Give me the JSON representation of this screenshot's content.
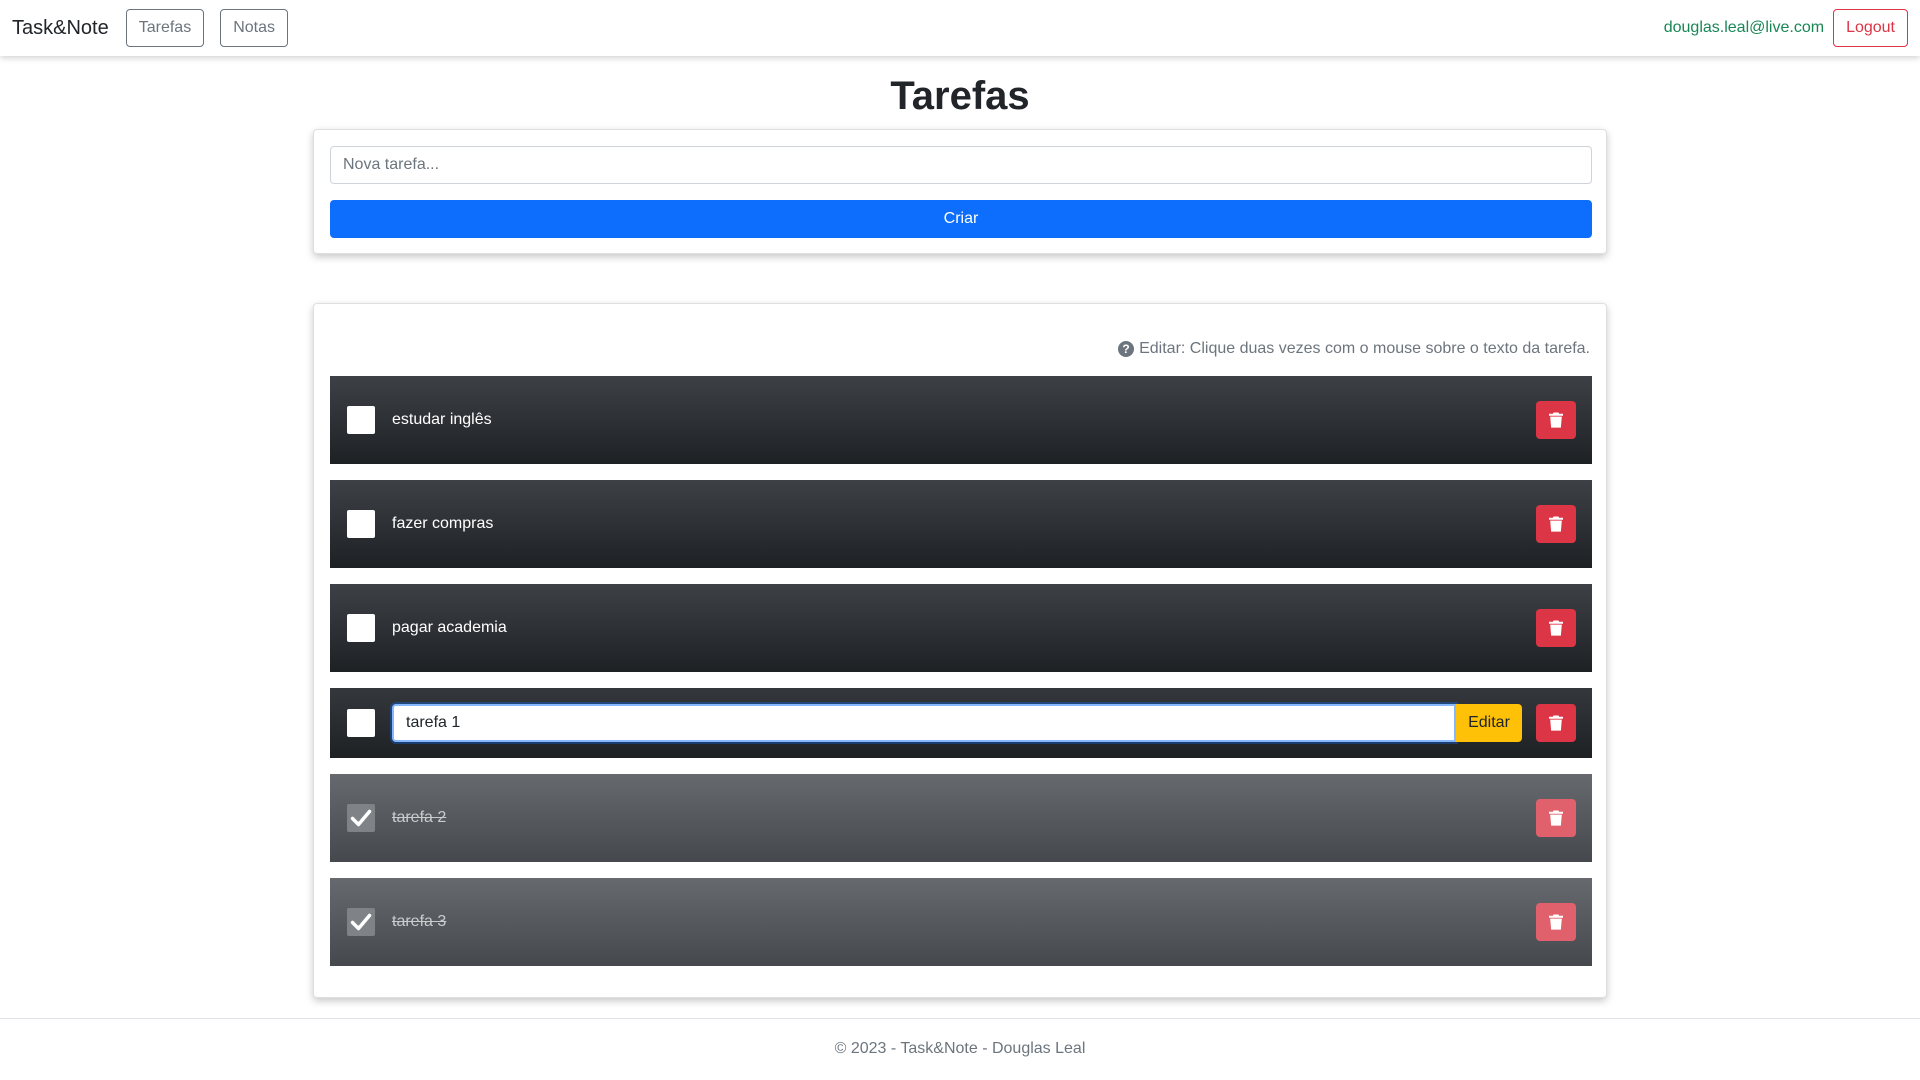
{
  "navbar": {
    "brand": "Task&Note",
    "links": [
      {
        "label": "Tarefas"
      },
      {
        "label": "Notas"
      }
    ],
    "user_email": "douglas.leal@live.com",
    "logout_label": "Logout"
  },
  "page": {
    "title": "Tarefas"
  },
  "new_task": {
    "placeholder": "Nova tarefa...",
    "create_label": "Criar"
  },
  "task_list": {
    "hint": "Editar: Clique duas vezes com o mouse sobre o texto da tarefa.",
    "tasks": [
      {
        "text": "estudar inglês",
        "done": false
      },
      {
        "text": "fazer compras",
        "done": false
      },
      {
        "text": "pagar academia",
        "done": false
      },
      {
        "text": "tarefa 1",
        "done": false,
        "editing": true,
        "edit_label": "Editar"
      },
      {
        "text": "tarefa 2",
        "done": true
      },
      {
        "text": "tarefa 3",
        "done": true
      }
    ]
  },
  "colors": {
    "primary": "#0d6efd",
    "danger": "#dc3545",
    "warning": "#ffc107",
    "success": "#198754",
    "secondary": "#6c757d"
  },
  "footer": {
    "text": "© 2023 - Task&Note - Douglas Leal"
  }
}
